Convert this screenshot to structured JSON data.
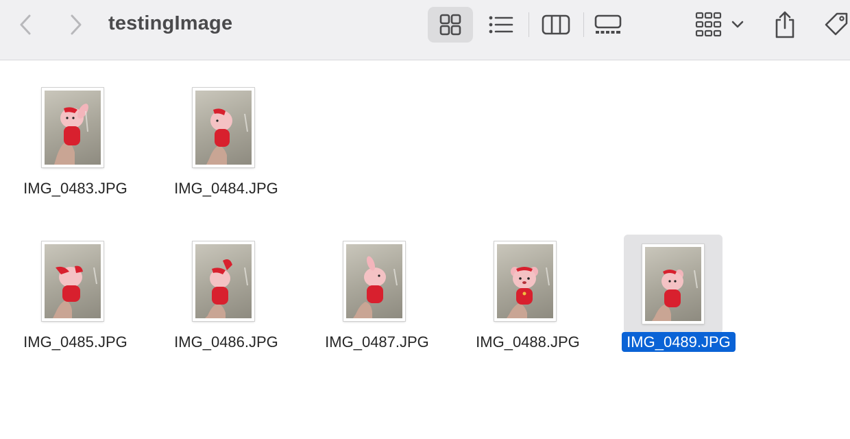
{
  "window": {
    "title": "testingImage"
  },
  "toolbar": {
    "back_icon": "chevron-left-icon",
    "forward_icon": "chevron-right-icon",
    "views": [
      {
        "name": "icon-view",
        "icon": "grid-icon",
        "selected": true
      },
      {
        "name": "list-view",
        "icon": "list-icon",
        "selected": false
      },
      {
        "name": "column-view",
        "icon": "columns-icon",
        "selected": false
      },
      {
        "name": "gallery-view",
        "icon": "gallery-icon",
        "selected": false
      }
    ],
    "group_icon": "group-grid-icon",
    "share_icon": "share-icon",
    "tag_icon": "tag-icon"
  },
  "files": [
    {
      "name": "IMG_0483.JPG",
      "selected": false
    },
    {
      "name": "IMG_0484.JPG",
      "selected": false
    },
    {
      "name": "IMG_0485.JPG",
      "selected": false
    },
    {
      "name": "IMG_0486.JPG",
      "selected": false
    },
    {
      "name": "IMG_0487.JPG",
      "selected": false
    },
    {
      "name": "IMG_0488.JPG",
      "selected": false
    },
    {
      "name": "IMG_0489.JPG",
      "selected": true
    }
  ],
  "colors": {
    "selection": "#0a63d6",
    "toolbar_bg": "#f0f0f2",
    "toy_pink": "#f4c2c4",
    "toy_red": "#d8202e"
  }
}
